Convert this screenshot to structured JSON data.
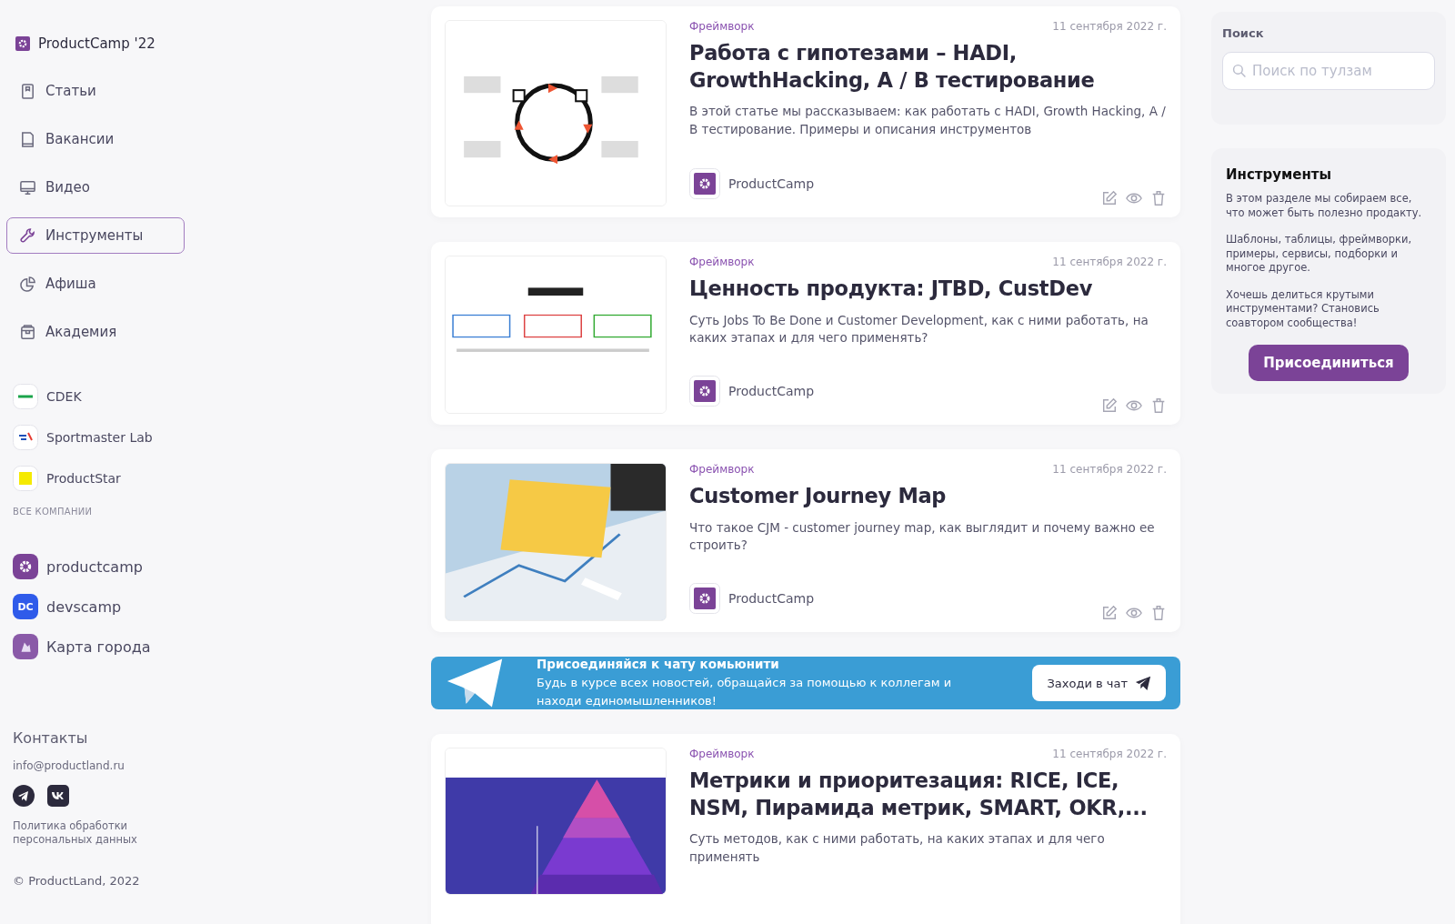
{
  "brand": {
    "name": "ProductCamp '22"
  },
  "nav": [
    {
      "label": "Статьи",
      "selected": false
    },
    {
      "label": "Вакансии",
      "selected": false
    },
    {
      "label": "Видео",
      "selected": false
    },
    {
      "label": "Инструменты",
      "selected": true
    },
    {
      "label": "Афиша",
      "selected": false
    },
    {
      "label": "Академия",
      "selected": false
    }
  ],
  "companies": [
    {
      "name": "CDEK"
    },
    {
      "name": "Sportmaster Lab"
    },
    {
      "name": "ProductStar"
    }
  ],
  "all_companies": "ВСЕ КОМПАНИИ",
  "communities": [
    {
      "name": "productcamp",
      "color": "#7b4397",
      "kind": "gear"
    },
    {
      "name": "devscamp",
      "color": "#2f5bea",
      "kind": "text",
      "logo_text": "DC"
    },
    {
      "name": "Карта города",
      "color": "#8a5aa8",
      "kind": "figure"
    }
  ],
  "contacts": {
    "title": "Контакты",
    "email": "info@productland.ru",
    "policy": "Политика обработки персональных данных",
    "copyright": "© ProductLand, 2022"
  },
  "articles": [
    {
      "category": "Фреймворк",
      "date": "11 сентября 2022 г.",
      "title": "Работа с гипотезами – HADI, GrowthHacking, A / B тестирование",
      "description": "В этой статье мы рассказываем: как работать с HADI, Growth Hacking, A / B тестирование. Примеры и описания инструментов",
      "author": "ProductCamp"
    },
    {
      "category": "Фреймворк",
      "date": "11 сентября 2022 г.",
      "title": "Ценность продукта: JTBD, CustDev",
      "description": "Суть Jobs To Be Done и Customer Development, как с ними работать, на каких этапах и для чего применять?",
      "author": "ProductCamp"
    },
    {
      "category": "Фреймворк",
      "date": "11 сентября 2022 г.",
      "title": "Customer Journey Map",
      "description": "Что такое CJM - customer journey map, как выглядит и почему важно ее строить?",
      "author": "ProductCamp"
    }
  ],
  "banner": {
    "title": "Присоединяйся к чату комьюнити",
    "text": "Будь в курсе всех новостей, обращайся за помощью к коллегам и находи единомышленников!",
    "button": "Заходи в чат"
  },
  "last_article": {
    "category": "Фреймворк",
    "date": "11 сентября 2022 г.",
    "title": "Метрики и приоритезация: RICE, ICE, NSM, Пирамида метрик, SMART, OKR,...",
    "description": "Суть методов, как с ними работать, на каких этапах и для чего применять"
  },
  "search": {
    "title": "Поиск",
    "placeholder": "Поиск по тулзам"
  },
  "info": {
    "title": "Инструменты",
    "paragraphs": [
      "В этом разделе мы собираем все, что может быть полезно продакту.",
      "Шаблоны, таблицы, фреймворки, примеры, сервисы, подборки и многое другое.",
      "Хочешь делиться крутыми инструментами? Становись соавтором сообщества!"
    ],
    "button": "Присоединиться"
  }
}
